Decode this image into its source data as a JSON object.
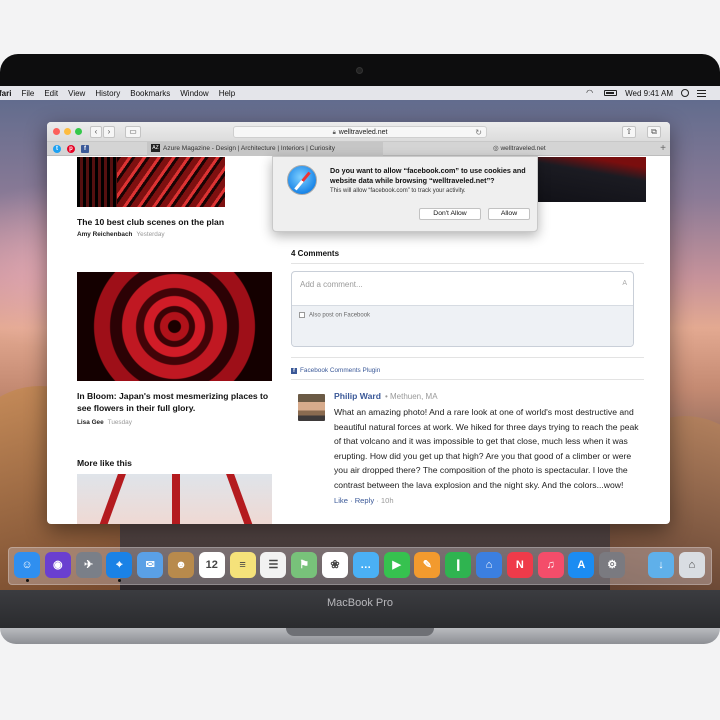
{
  "device": {
    "brand_label": "MacBook Pro"
  },
  "menubar": {
    "app_name": "fari",
    "items": [
      "File",
      "Edit",
      "View",
      "History",
      "Bookmarks",
      "Window",
      "Help"
    ],
    "clock": "Wed 9:41 AM"
  },
  "browser": {
    "address": "welltraveled.net",
    "tabs": [
      {
        "badge": "AZ",
        "label": "Azure Magazine - Design | Architecture | Interiors | Curiosity"
      },
      {
        "label": "welltraveled.net"
      }
    ],
    "favorites": [
      {
        "icon": "twitter-icon",
        "glyph": "t",
        "color": "#1da1f2"
      },
      {
        "icon": "pinterest-icon",
        "glyph": "p",
        "color": "#e60023"
      },
      {
        "icon": "facebook-icon",
        "glyph": "f",
        "color": "#3b5998"
      }
    ]
  },
  "dialog": {
    "title": "Do you want to allow “facebook.com” to use cookies and website data while browsing “welltraveled.net”?",
    "subtitle": "This will allow “facebook.com” to track your activity.",
    "dont_allow": "Don't Allow",
    "allow": "Allow"
  },
  "articles": [
    {
      "title": "The 10 best club scenes on the plan",
      "author": "Amy Reichenbach",
      "date": "Yesterday"
    },
    {
      "title": "In Bloom: Japan's most mesmerizing places to see flowers in their full glory.",
      "author": "Lisa Gee",
      "date": "Tuesday"
    }
  ],
  "more_like_this": "More like this",
  "comments": {
    "heading": "4 Comments",
    "placeholder": "Add a comment...",
    "also_post": "Also post on Facebook",
    "plugin": "Facebook Comments Plugin",
    "entry": {
      "name": "Philip Ward",
      "location": "• Methuen, MA",
      "text": "What an amazing photo! And a rare look at one of world's most destructive and beautiful natural forces at work. We hiked for three days trying to reach the peak of that volcano and it was impossible to get that close, much less when it was erupting. How did you get up that high? Are you that good of a climber or were you air dropped there? The composition of the photo is spectacular. I love the contrast between the lava explosion and the night sky. And the colors...wow!",
      "like": "Like",
      "reply": "Reply",
      "time": "10h"
    }
  },
  "dock": [
    {
      "name": "finder-icon",
      "color": "#2f8ff0",
      "glyph": "☺"
    },
    {
      "name": "siri-icon",
      "color": "#6a3fd0",
      "glyph": "◉"
    },
    {
      "name": "launchpad-icon",
      "color": "#7a7f88",
      "glyph": "✈"
    },
    {
      "name": "safari-icon",
      "color": "#1a82e6",
      "glyph": "⌖"
    },
    {
      "name": "mail-icon",
      "color": "#5aa0e6",
      "glyph": "✉"
    },
    {
      "name": "contacts-icon",
      "color": "#b88a4c",
      "glyph": "☻"
    },
    {
      "name": "calendar-icon",
      "color": "#ffffff",
      "glyph": "12"
    },
    {
      "name": "notes-icon",
      "color": "#f5e27a",
      "glyph": "≡"
    },
    {
      "name": "reminders-icon",
      "color": "#f2f2f2",
      "glyph": "☰"
    },
    {
      "name": "maps-icon",
      "color": "#78c27a",
      "glyph": "⚑"
    },
    {
      "name": "photos-icon",
      "color": "#ffffff",
      "glyph": "❀"
    },
    {
      "name": "messages-icon",
      "color": "#4ab0f5",
      "glyph": "…"
    },
    {
      "name": "facetime-icon",
      "color": "#36c24f",
      "glyph": "▶"
    },
    {
      "name": "pages-icon",
      "color": "#f29a2e",
      "glyph": "✎"
    },
    {
      "name": "numbers-icon",
      "color": "#2fb450",
      "glyph": "❙"
    },
    {
      "name": "keynote-icon",
      "color": "#3b7fe0",
      "glyph": "⌂"
    },
    {
      "name": "news-icon",
      "color": "#ef3b4a",
      "glyph": "N"
    },
    {
      "name": "music-icon",
      "color": "#f44d6a",
      "glyph": "♫"
    },
    {
      "name": "app-store-icon",
      "color": "#1b8cf2",
      "glyph": "A"
    },
    {
      "name": "system-preferences-icon",
      "color": "#7a7a80",
      "glyph": "⚙"
    },
    {
      "name": "downloads-folder-icon",
      "color": "#5fb0ea",
      "glyph": "↓"
    },
    {
      "name": "trash-icon",
      "color": "#d9dde2",
      "glyph": "⌂"
    }
  ]
}
